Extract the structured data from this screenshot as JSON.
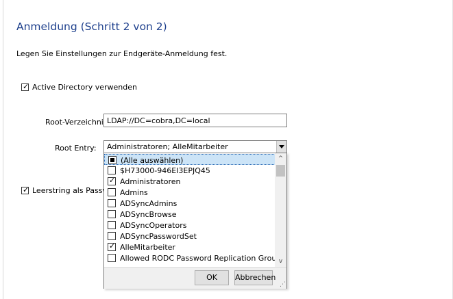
{
  "header": {
    "title": "Anmeldung (Schritt 2 von 2)",
    "subtitle": "Legen Sie Einstellungen zur Endgeräte-Anmeldung fest."
  },
  "active_directory": {
    "label": "Active Directory verwenden",
    "checked": true
  },
  "root_directory": {
    "label": "Root-Verzeichnis:",
    "value": "LDAP://DC=cobra,DC=local"
  },
  "root_entry": {
    "label": "Root Entry:",
    "value": "Administratoren; AlleMitarbeiter",
    "items": [
      {
        "label": "(Alle auswählen)",
        "state": "partial"
      },
      {
        "label": "$H73000-946EI3EPJQ45",
        "state": "unchecked"
      },
      {
        "label": "Administratoren",
        "state": "checked"
      },
      {
        "label": "Admins",
        "state": "unchecked"
      },
      {
        "label": "ADSyncAdmins",
        "state": "unchecked"
      },
      {
        "label": "ADSyncBrowse",
        "state": "unchecked"
      },
      {
        "label": "ADSyncOperators",
        "state": "unchecked"
      },
      {
        "label": "ADSyncPasswordSet",
        "state": "unchecked"
      },
      {
        "label": "AlleMitarbeiter",
        "state": "checked"
      },
      {
        "label": "Allowed RODC Password Replication Group",
        "state": "unchecked"
      }
    ],
    "ok_label": "OK",
    "cancel_label": "Abbrechen"
  },
  "empty_string": {
    "label": "Leerstring als Passwort",
    "checked": true
  },
  "icons": {
    "check": "✓",
    "scroll_up": "^",
    "scroll_down": "v",
    "grip": "⋰"
  }
}
